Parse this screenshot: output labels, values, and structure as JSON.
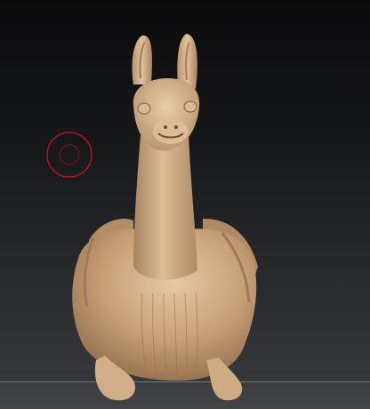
{
  "scene": {
    "subject_icon": "llama-sculpt",
    "brush_icon": "brush-cursor-circle",
    "colors": {
      "clay": "#c9a27a",
      "clay_light": "#e2c4a0",
      "clay_dark": "#8c6848",
      "brush_ring": "#b3121c",
      "background_top": "#0b0b0c",
      "background_bottom": "#3a3b3e",
      "floor_line": "#8a8a8a"
    }
  }
}
